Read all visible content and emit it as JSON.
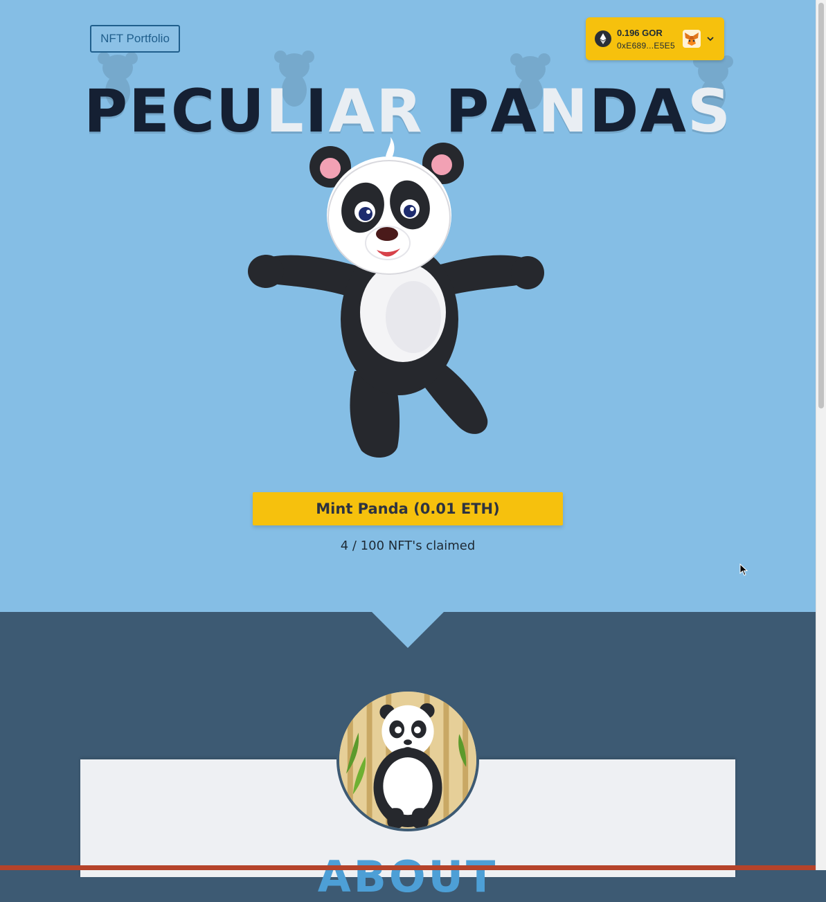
{
  "header": {
    "portfolio_label": "NFT Portfolio",
    "wallet": {
      "balance": "0.196 GOR",
      "address": "0xE689...E5E5",
      "network_icon": "ethereum-icon",
      "wallet_icon": "metamask-fox-icon",
      "dropdown_icon": "chevron-down-icon"
    }
  },
  "hero": {
    "title": "PECULIAR PANDAS",
    "mint_button_label": "Mint Panda (0.01 ETH)",
    "claimed_text": "4 / 100 NFT's claimed",
    "claimed_count": 4,
    "supply_total": 100
  },
  "about": {
    "heading": "ABOUT"
  },
  "colors": {
    "hero_bg": "#85bee5",
    "section_bg": "#3d5a73",
    "accent_yellow": "#f6c10d",
    "title_dark": "#152033",
    "about_heading": "#4d9fd6"
  }
}
